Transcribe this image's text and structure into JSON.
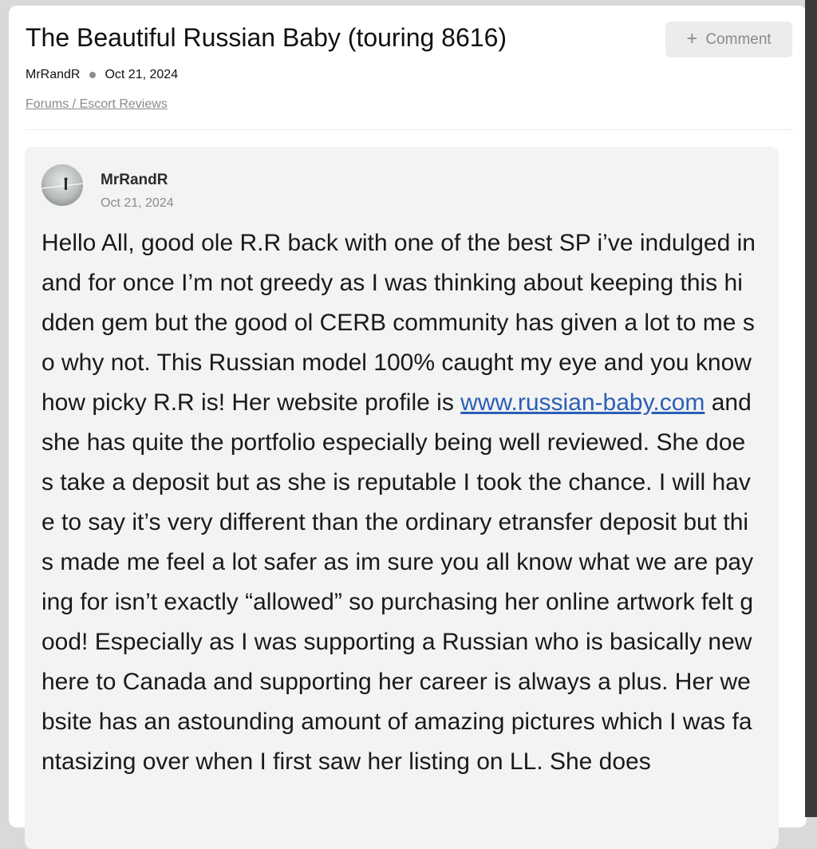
{
  "thread": {
    "title": "The Beautiful Russian Baby (touring 8616)",
    "author": "MrRandR",
    "date": "Oct 21, 2024",
    "breadcrumb": "Forums / Escort Reviews",
    "comment_label": "Comment",
    "comment_icon": "plus-icon"
  },
  "post": {
    "author": "MrRandR",
    "date": "Oct 21, 2024",
    "avatar_icon": "user-avatar",
    "text_before_link": "Hello All, good ole R.R back with one of the best SP i’ve indulged in and for once I’m not greedy as I was thinking about keeping this hidden gem but the good ol CERB community has given a lot to me so why not. This Russian model 100% caught my eye and you know how picky R.R is! Her website profile is ",
    "link_text": "www.russian-baby.com",
    "text_after_link": " and she has quite the portfolio especially being well reviewed. She does take a deposit but as she is reputable I took the chance. I will have to say it’s very different than the ordinary etransfer deposit but this made me feel a lot safer as im sure you all know what we are paying for isn’t exactly “allowed” so purchasing her online artwork felt good! Especially as I was supporting a Russian who is basically new here to Canada and supporting her career is always a plus. Her website has an astounding amount of amazing pictures which I was fantasizing over when I first saw her listing on LL. She does"
  },
  "colors": {
    "link": "#2b5fb6",
    "card_background": "#f3f3f3",
    "button_background": "#ececec"
  }
}
